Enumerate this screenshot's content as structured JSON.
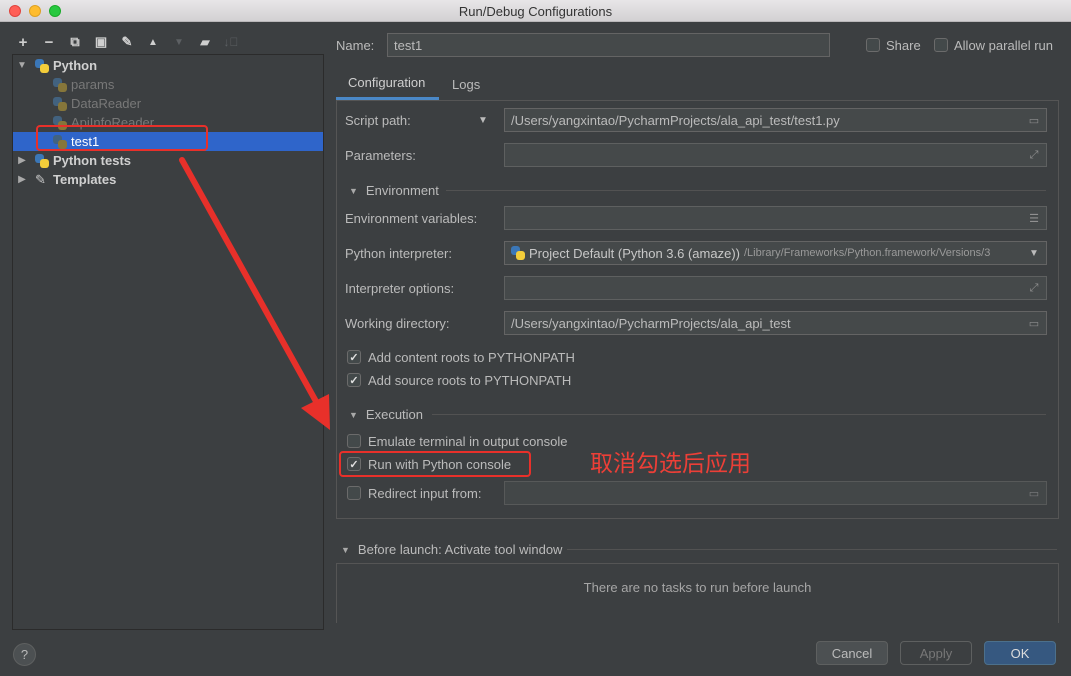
{
  "window": {
    "title": "Run/Debug Configurations"
  },
  "toolbar": {
    "add": "+",
    "remove": "−",
    "copy": "⧉",
    "save": "▣",
    "edit": "✎",
    "up": "▲",
    "down": "▼",
    "folder": "▰",
    "sort": "↓⃨"
  },
  "tree": {
    "python": "Python",
    "items": [
      "params",
      "DataReader",
      "ApiInfoReader",
      "test1"
    ],
    "python_tests": "Python tests",
    "templates": "Templates"
  },
  "header": {
    "name_label": "Name:",
    "name_value": "test1",
    "share_label": "Share",
    "allow_parallel_label": "Allow parallel run"
  },
  "tabs": [
    "Configuration",
    "Logs"
  ],
  "config": {
    "script_path_label": "Script path:",
    "script_path_value": "/Users/yangxintao/PycharmProjects/ala_api_test/test1.py",
    "parameters_label": "Parameters:",
    "environment_header": "Environment",
    "env_vars_label": "Environment variables:",
    "interpreter_label": "Python interpreter:",
    "interpreter_value": "Project Default (Python 3.6 (amaze))",
    "interpreter_path": "/Library/Frameworks/Python.framework/Versions/3",
    "interp_options_label": "Interpreter options:",
    "working_dir_label": "Working directory:",
    "working_dir_value": "/Users/yangxintao/PycharmProjects/ala_api_test",
    "content_roots_label": "Add content roots to PYTHONPATH",
    "content_roots_checked": true,
    "source_roots_label": "Add source roots to PYTHONPATH",
    "source_roots_checked": true,
    "execution_header": "Execution",
    "emulate_terminal_label": "Emulate terminal in output console",
    "emulate_terminal_checked": false,
    "run_console_label": "Run with Python console",
    "run_console_checked": true,
    "redirect_label": "Redirect input from:",
    "redirect_checked": false
  },
  "before_launch": {
    "header": "Before launch: Activate tool window",
    "empty_message": "There are no tasks to run before launch"
  },
  "annotation": {
    "text": "取消勾选后应用"
  },
  "buttons": {
    "help": "?",
    "cancel": "Cancel",
    "apply": "Apply",
    "ok": "OK"
  },
  "colors": {
    "selection": "#2f65ca",
    "annotation_red": "#e8302a",
    "ok_button": "#365880"
  }
}
